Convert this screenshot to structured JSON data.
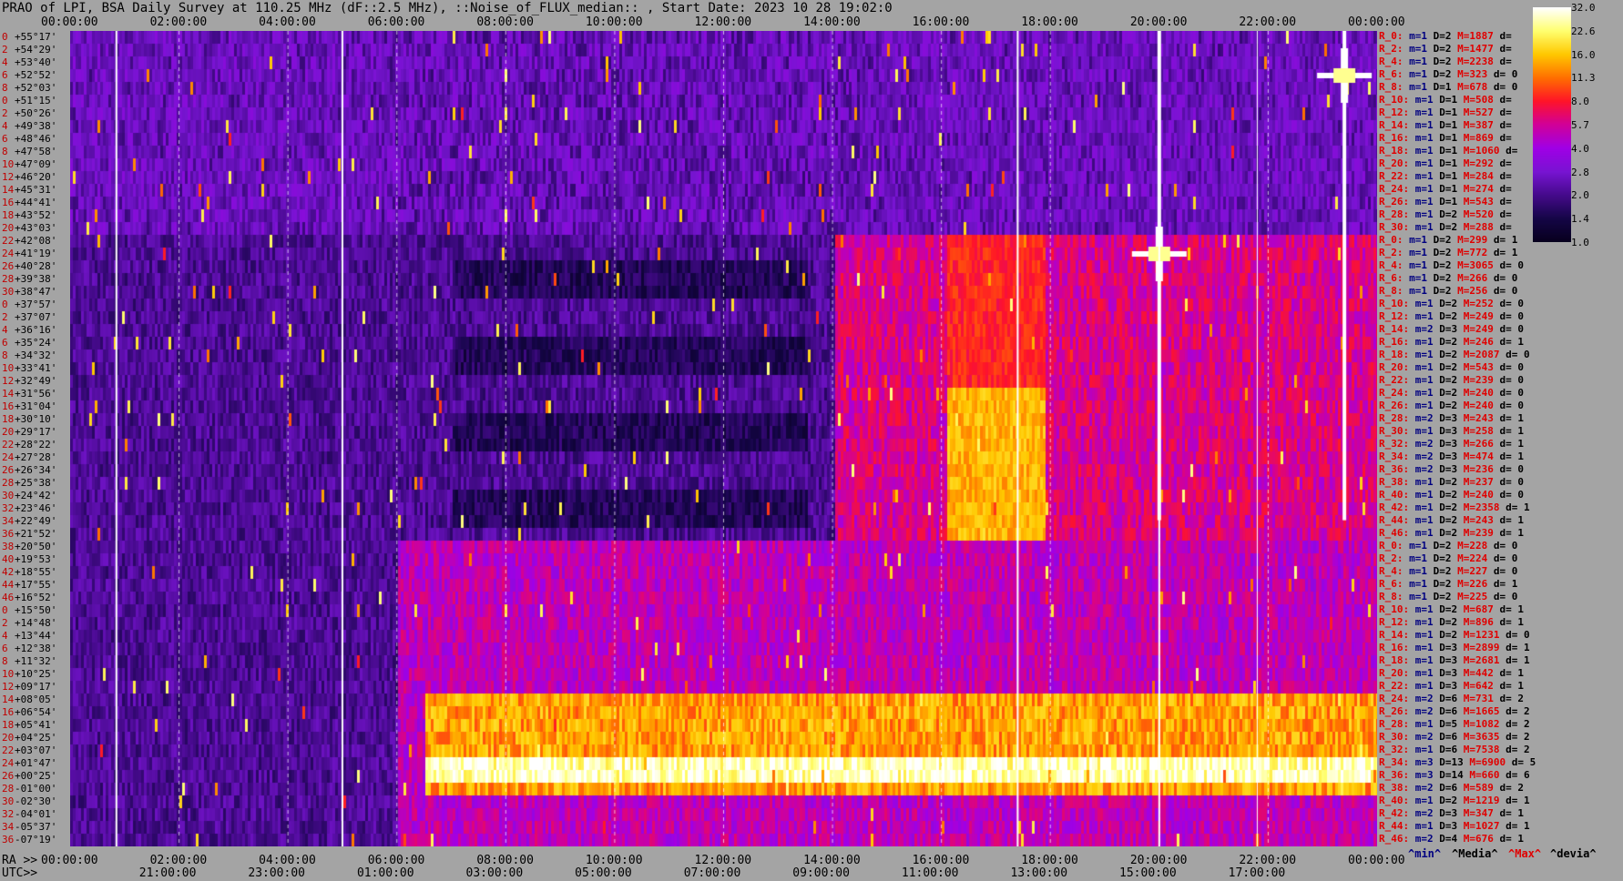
{
  "title": "PRAO of LPI, BSA Daily Survey at 110.25 MHz (dF::2.5 MHz), ::Noise_of_FLUX_median:: , Start Date: 2023 10 28 19:02:0",
  "top_ticks": [
    "00:00:00",
    "02:00:00",
    "04:00:00",
    "06:00:00",
    "08:00:00",
    "10:00:00",
    "12:00:00",
    "14:00:00",
    "16:00:00",
    "18:00:00",
    "20:00:00",
    "22:00:00",
    "00:00:00"
  ],
  "ra_label": "RA >>",
  "ra_ticks": [
    "00:00:00",
    "02:00:00",
    "04:00:00",
    "06:00:00",
    "08:00:00",
    "10:00:00",
    "12:00:00",
    "14:00:00",
    "16:00:00",
    "18:00:00",
    "20:00:00",
    "22:00:00",
    "00:00:00"
  ],
  "utc_label": "UTC>>",
  "utc_ticks": [
    "21:00:00",
    "23:00:00",
    "01:00:00",
    "03:00:00",
    "05:00:00",
    "07:00:00",
    "09:00:00",
    "11:00:00",
    "13:00:00",
    "15:00:00",
    "17:00:00"
  ],
  "declinations": [
    "+55°17'",
    "+54°29'",
    "+53°40'",
    "+52°52'",
    "+52°03'",
    "+51°15'",
    "+50°26'",
    "+49°38'",
    "+48°46'",
    "+47°58'",
    "+47°09'",
    "+46°20'",
    "+45°31'",
    "+44°41'",
    "+43°52'",
    "+43°03'",
    "+42°08'",
    "+41°19'",
    "+40°28'",
    "+39°38'",
    "+38°47'",
    "+37°57'",
    "+37°07'",
    "+36°16'",
    "+35°24'",
    "+34°32'",
    "+33°41'",
    "+32°49'",
    "+31°56'",
    "+31°04'",
    "+30°10'",
    "+29°17'",
    "+28°22'",
    "+27°28'",
    "+26°34'",
    "+25°38'",
    "+24°42'",
    "+23°46'",
    "+22°49'",
    "+21°52'",
    "+20°50'",
    "+19°53'",
    "+18°55'",
    "+17°55'",
    "+16°52'",
    "+15°50'",
    "+14°48'",
    "+13°44'",
    "+12°38'",
    "+11°32'",
    "+10°25'",
    "+09°17'",
    "+08°05'",
    "+06°54'",
    "+05°41'",
    "+04°25'",
    "+03°07'",
    "+01°47'",
    "+00°25'",
    "-01°00'",
    "-02°30'",
    "-04°01'",
    "-05°37'",
    "-07°19'"
  ],
  "row_indices": [
    "0",
    "2",
    "4",
    "6",
    "8",
    "0",
    "2",
    "4",
    "6",
    "8",
    "10",
    "12",
    "14",
    "16",
    "18",
    "20",
    "22",
    "24",
    "26",
    "28",
    "30",
    "0",
    "2",
    "4",
    "6",
    "8",
    "10",
    "12",
    "14",
    "16",
    "18",
    "20",
    "22",
    "24",
    "26",
    "28",
    "30",
    "32",
    "34",
    "36",
    "38",
    "40",
    "42",
    "44",
    "46",
    "0",
    "2",
    "4",
    "6",
    "8",
    "10",
    "12",
    "14",
    "16",
    "18",
    "20",
    "22",
    "24",
    "26",
    "28",
    "30",
    "32",
    "34",
    "36"
  ],
  "stats": [
    {
      "r": "R_0:",
      "m": "m=1",
      "D": "D=2",
      "M": "M=1887",
      "d": "d="
    },
    {
      "r": "R_2:",
      "m": "m=1",
      "D": "D=2",
      "M": "M=1477",
      "d": "d="
    },
    {
      "r": "R_4:",
      "m": "m=1",
      "D": "D=2",
      "M": "M=2238",
      "d": "d="
    },
    {
      "r": "R_6:",
      "m": "m=1",
      "D": "D=2",
      "M": "M=323",
      "d": "d= 0"
    },
    {
      "r": "R_8:",
      "m": "m=1",
      "D": "D=1",
      "M": "M=678",
      "d": "d= 0"
    },
    {
      "r": "R_10:",
      "m": "m=1",
      "D": "D=1",
      "M": "M=508",
      "d": "d="
    },
    {
      "r": "R_12:",
      "m": "m=1",
      "D": "D=1",
      "M": "M=527",
      "d": "d="
    },
    {
      "r": "R_14:",
      "m": "m=1",
      "D": "D=1",
      "M": "M=387",
      "d": "d="
    },
    {
      "r": "R_16:",
      "m": "m=1",
      "D": "D=1",
      "M": "M=869",
      "d": "d="
    },
    {
      "r": "R_18:",
      "m": "m=1",
      "D": "D=1",
      "M": "M=1060",
      "d": "d="
    },
    {
      "r": "R_20:",
      "m": "m=1",
      "D": "D=1",
      "M": "M=292",
      "d": "d="
    },
    {
      "r": "R_22:",
      "m": "m=1",
      "D": "D=1",
      "M": "M=284",
      "d": "d="
    },
    {
      "r": "R_24:",
      "m": "m=1",
      "D": "D=1",
      "M": "M=274",
      "d": "d="
    },
    {
      "r": "R_26:",
      "m": "m=1",
      "D": "D=1",
      "M": "M=543",
      "d": "d="
    },
    {
      "r": "R_28:",
      "m": "m=1",
      "D": "D=2",
      "M": "M=520",
      "d": "d="
    },
    {
      "r": "R_30:",
      "m": "m=1",
      "D": "D=2",
      "M": "M=288",
      "d": "d="
    },
    {
      "r": "R_0:",
      "m": "m=1",
      "D": "D=2",
      "M": "M=299",
      "d": "d= 1"
    },
    {
      "r": "R_2:",
      "m": "m=1",
      "D": "D=2",
      "M": "M=772",
      "d": "d= 1"
    },
    {
      "r": "R_4:",
      "m": "m=1",
      "D": "D=2",
      "M": "M=3065",
      "d": "d= 0"
    },
    {
      "r": "R_6:",
      "m": "m=1",
      "D": "D=2",
      "M": "M=266",
      "d": "d= 0"
    },
    {
      "r": "R_8:",
      "m": "m=1",
      "D": "D=2",
      "M": "M=256",
      "d": "d= 0"
    },
    {
      "r": "R_10:",
      "m": "m=1",
      "D": "D=2",
      "M": "M=252",
      "d": "d= 0"
    },
    {
      "r": "R_12:",
      "m": "m=1",
      "D": "D=2",
      "M": "M=249",
      "d": "d= 0"
    },
    {
      "r": "R_14:",
      "m": "m=2",
      "D": "D=3",
      "M": "M=249",
      "d": "d= 0"
    },
    {
      "r": "R_16:",
      "m": "m=1",
      "D": "D=2",
      "M": "M=246",
      "d": "d= 1"
    },
    {
      "r": "R_18:",
      "m": "m=1",
      "D": "D=2",
      "M": "M=2087",
      "d": "d= 0"
    },
    {
      "r": "R_20:",
      "m": "m=1",
      "D": "D=2",
      "M": "M=543",
      "d": "d= 0"
    },
    {
      "r": "R_22:",
      "m": "m=1",
      "D": "D=2",
      "M": "M=239",
      "d": "d= 0"
    },
    {
      "r": "R_24:",
      "m": "m=1",
      "D": "D=2",
      "M": "M=240",
      "d": "d= 0"
    },
    {
      "r": "R_26:",
      "m": "m=1",
      "D": "D=2",
      "M": "M=240",
      "d": "d= 0"
    },
    {
      "r": "R_28:",
      "m": "m=2",
      "D": "D=3",
      "M": "M=243",
      "d": "d= 1"
    },
    {
      "r": "R_30:",
      "m": "m=1",
      "D": "D=3",
      "M": "M=258",
      "d": "d= 1"
    },
    {
      "r": "R_32:",
      "m": "m=2",
      "D": "D=3",
      "M": "M=266",
      "d": "d= 1"
    },
    {
      "r": "R_34:",
      "m": "m=2",
      "D": "D=3",
      "M": "M=474",
      "d": "d= 1"
    },
    {
      "r": "R_36:",
      "m": "m=2",
      "D": "D=3",
      "M": "M=236",
      "d": "d= 0"
    },
    {
      "r": "R_38:",
      "m": "m=1",
      "D": "D=2",
      "M": "M=237",
      "d": "d= 0"
    },
    {
      "r": "R_40:",
      "m": "m=1",
      "D": "D=2",
      "M": "M=240",
      "d": "d= 0"
    },
    {
      "r": "R_42:",
      "m": "m=1",
      "D": "D=2",
      "M": "M=2358",
      "d": "d= 1"
    },
    {
      "r": "R_44:",
      "m": "m=1",
      "D": "D=2",
      "M": "M=243",
      "d": "d= 1"
    },
    {
      "r": "R_46:",
      "m": "m=1",
      "D": "D=2",
      "M": "M=239",
      "d": "d= 1"
    },
    {
      "r": "R_0:",
      "m": "m=1",
      "D": "D=2",
      "M": "M=228",
      "d": "d= 0"
    },
    {
      "r": "R_2:",
      "m": "m=1",
      "D": "D=2",
      "M": "M=224",
      "d": "d= 0"
    },
    {
      "r": "R_4:",
      "m": "m=1",
      "D": "D=2",
      "M": "M=227",
      "d": "d= 0"
    },
    {
      "r": "R_6:",
      "m": "m=1",
      "D": "D=2",
      "M": "M=226",
      "d": "d= 1"
    },
    {
      "r": "R_8:",
      "m": "m=1",
      "D": "D=2",
      "M": "M=225",
      "d": "d= 0"
    },
    {
      "r": "R_10:",
      "m": "m=1",
      "D": "D=2",
      "M": "M=687",
      "d": "d= 1"
    },
    {
      "r": "R_12:",
      "m": "m=1",
      "D": "D=2",
      "M": "M=896",
      "d": "d= 1"
    },
    {
      "r": "R_14:",
      "m": "m=1",
      "D": "D=2",
      "M": "M=1231",
      "d": "d= 0"
    },
    {
      "r": "R_16:",
      "m": "m=1",
      "D": "D=3",
      "M": "M=2899",
      "d": "d= 1"
    },
    {
      "r": "R_18:",
      "m": "m=1",
      "D": "D=3",
      "M": "M=2681",
      "d": "d= 1"
    },
    {
      "r": "R_20:",
      "m": "m=1",
      "D": "D=3",
      "M": "M=442",
      "d": "d= 1"
    },
    {
      "r": "R_22:",
      "m": "m=1",
      "D": "D=3",
      "M": "M=642",
      "d": "d= 1"
    },
    {
      "r": "R_24:",
      "m": "m=2",
      "D": "D=6",
      "M": "M=731",
      "d": "d= 2"
    },
    {
      "r": "R_26:",
      "m": "m=2",
      "D": "D=6",
      "M": "M=1665",
      "d": "d= 2"
    },
    {
      "r": "R_28:",
      "m": "m=1",
      "D": "D=5",
      "M": "M=1082",
      "d": "d= 2"
    },
    {
      "r": "R_30:",
      "m": "m=2",
      "D": "D=6",
      "M": "M=3635",
      "d": "d= 2"
    },
    {
      "r": "R_32:",
      "m": "m=1",
      "D": "D=6",
      "M": "M=7538",
      "d": "d= 2"
    },
    {
      "r": "R_34:",
      "m": "m=3",
      "D": "D=13",
      "M": "M=6900",
      "d": "d= 5"
    },
    {
      "r": "R_36:",
      "m": "m=3",
      "D": "D=14",
      "M": "M=660",
      "d": "d= 6"
    },
    {
      "r": "R_38:",
      "m": "m=2",
      "D": "D=6",
      "M": "M=589",
      "d": "d= 2"
    },
    {
      "r": "R_40:",
      "m": "m=1",
      "D": "D=2",
      "M": "M=1219",
      "d": "d= 1"
    },
    {
      "r": "R_42:",
      "m": "m=2",
      "D": "D=3",
      "M": "M=347",
      "d": "d= 1"
    },
    {
      "r": "R_44:",
      "m": "m=1",
      "D": "D=3",
      "M": "M=1027",
      "d": "d= 1"
    },
    {
      "r": "R_46:",
      "m": "m=2",
      "D": "D=4",
      "M": "M=676",
      "d": "d= 1"
    }
  ],
  "legend": {
    "min": "^min^",
    "median": "^Media^",
    "max": "^Max^",
    "devia": "^devia^"
  },
  "colorbar": {
    "labels": [
      "32.0",
      "22.6",
      "16.0",
      "11.3",
      "8.0",
      "5.7",
      "4.0",
      "2.8",
      "2.0",
      "1.4",
      "1.0"
    ],
    "colors": [
      "#ffffff",
      "#ffff80",
      "#ffd000",
      "#ff8000",
      "#ff2000",
      "#c8008a",
      "#9b00e6",
      "#6a00c8",
      "#3a0080",
      "#100030"
    ]
  },
  "chart_data": {
    "type": "heatmap",
    "x_axis_top": "RA 00:00:00 – 24:00:00",
    "colorscale_range": [
      1.0,
      32.0
    ],
    "bands": [
      {
        "rows": [
          0,
          15
        ],
        "ra_start": 0,
        "ra_end": 24,
        "level": 2.5
      },
      {
        "rows": [
          16,
          39
        ],
        "ra_start": 14,
        "ra_end": 24,
        "level": 6.0
      },
      {
        "rows": [
          40,
          63
        ],
        "ra_start": 6,
        "ra_end": 24,
        "level": 5.0
      },
      {
        "rows": [
          52,
          59
        ],
        "ra_start": 6.5,
        "ra_end": 24,
        "level": 14.0
      },
      {
        "rows": [
          57,
          58
        ],
        "ra_start": 6.5,
        "ra_end": 24,
        "level": 28.0
      }
    ],
    "point_sources": [
      {
        "name": "",
        "ra": 20.0,
        "row": 17,
        "level": 32.0
      },
      {
        "name": "",
        "ra": 23.4,
        "row": 3,
        "level": 20.0
      }
    ]
  }
}
